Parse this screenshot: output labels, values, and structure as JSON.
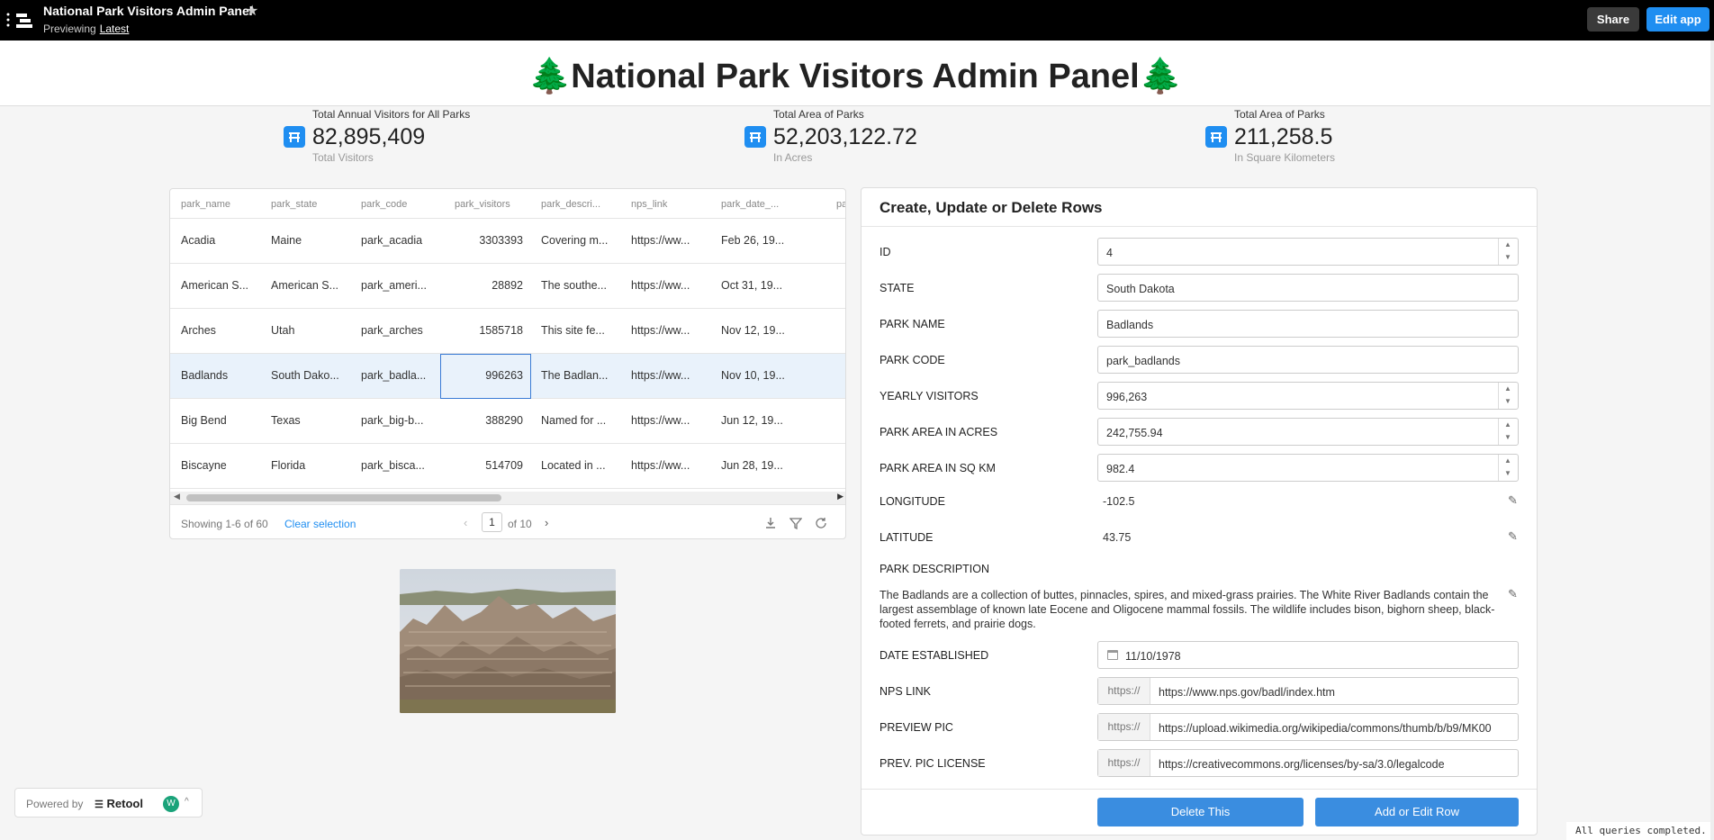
{
  "topbar": {
    "title": "National Park Visitors Admin Panel",
    "previewing": "Previewing",
    "version": "Latest",
    "share": "Share",
    "edit": "Edit app"
  },
  "header": {
    "title": "🌲National Park Visitors Admin Panel🌲"
  },
  "stats": [
    {
      "label": "Total Annual Visitors for All Parks",
      "value": "82,895,409",
      "sub": "Total Visitors"
    },
    {
      "label": "Total Area of Parks",
      "value": "52,203,122.72",
      "sub": "In Acres"
    },
    {
      "label": "Total Area of Parks",
      "value": "211,258.5",
      "sub": "In Square Kilometers"
    }
  ],
  "table": {
    "columns": [
      "park_name",
      "park_state",
      "park_code",
      "park_visitors",
      "park_descri...",
      "nps_link",
      "park_date_...",
      "pa"
    ],
    "rows": [
      [
        "Acadia",
        "Maine",
        "park_acadia",
        "3303393",
        "Covering m...",
        "https://ww...",
        "Feb 26, 19..."
      ],
      [
        "American S...",
        "American S...",
        "park_ameri...",
        "28892",
        "The southe...",
        "https://ww...",
        "Oct 31, 19..."
      ],
      [
        "Arches",
        "Utah",
        "park_arches",
        "1585718",
        "This site fe...",
        "https://ww...",
        "Nov 12, 19..."
      ],
      [
        "Badlands",
        "South Dako...",
        "park_badla...",
        "996263",
        "The Badlan...",
        "https://ww...",
        "Nov 10, 19..."
      ],
      [
        "Big Bend",
        "Texas",
        "park_big-b...",
        "388290",
        "Named for ...",
        "https://ww...",
        "Jun 12, 19..."
      ],
      [
        "Biscayne",
        "Florida",
        "park_bisca...",
        "514709",
        "Located in ...",
        "https://ww...",
        "Jun 28, 19..."
      ]
    ],
    "selected_row": 3,
    "showing": "Showing 1-6 of 60",
    "clear": "Clear selection",
    "page": "1",
    "of": "of 10"
  },
  "form": {
    "title": "Create, Update or Delete Rows",
    "id_label": "ID",
    "id_value": "4",
    "state_label": "STATE",
    "state_value": "South Dakota",
    "name_label": "PARK NAME",
    "name_value": "Badlands",
    "code_label": "PARK CODE",
    "code_value": "park_badlands",
    "visitors_label": "YEARLY VISITORS",
    "visitors_value": "996,263",
    "acres_label": "PARK AREA IN ACRES",
    "acres_value": "242,755.94",
    "sqkm_label": "PARK AREA IN SQ KM",
    "sqkm_value": "982.4",
    "lon_label": "LONGITUDE",
    "lon_value": "-102.5",
    "lat_label": "LATITUDE",
    "lat_value": "43.75",
    "desc_label": "PARK DESCRIPTION",
    "desc_value": "The Badlands are a collection of buttes, pinnacles, spires, and mixed-grass prairies. The White River Badlands contain the largest assemblage of known late Eocene and Oligocene mammal fossils. The wildlife includes bison, bighorn sheep, black-footed ferrets, and prairie dogs.",
    "date_label": "DATE ESTABLISHED",
    "date_value": "11/10/1978",
    "nps_label": "NPS LINK",
    "nps_prefix": "https://",
    "nps_value": "https://www.nps.gov/badl/index.htm",
    "pic_label": "PREVIEW PIC",
    "pic_prefix": "https://",
    "pic_value": "https://upload.wikimedia.org/wikipedia/commons/thumb/b/b9/MK00",
    "lic_label": "PREV. PIC LICENSE",
    "lic_prefix": "https://",
    "lic_value": "https://creativecommons.org/licenses/by-sa/3.0/legalcode",
    "delete": "Delete This",
    "add": "Add or Edit Row"
  },
  "footer": {
    "powered": "Powered by",
    "brand": "Retool",
    "avatar": "W",
    "status": "All queries completed."
  }
}
